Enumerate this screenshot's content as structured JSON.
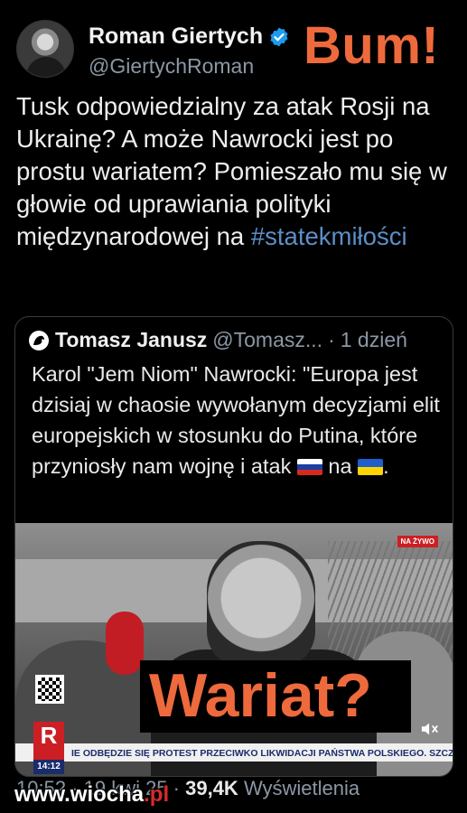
{
  "author": {
    "name": "Roman Giertych",
    "handle": "@GiertychRoman",
    "verified_color": "#1d9bf0"
  },
  "overlay_caption": "Bum!",
  "tweet": {
    "text": "Tusk odpowiedzialny za atak Rosji na Ukrainę? A może Nawrocki jest po prostu wariatem? Pomieszało mu się w głowie od uprawiania polityki międzynarodowej na ",
    "hashtag": "#statekmiłości"
  },
  "quote": {
    "name": "Tomasz Janusz",
    "handle": "@Tomasz...",
    "separator": "·",
    "time": "1 dzień",
    "text_before": "Karol \"Jem Niom\" Nawrocki: \"Europa jest dzisiaj w chaosie wywołanym decyzjami elit europejskich w stosunku do Putina, które przyniosły nam wojnę i atak ",
    "text_middle": " na ",
    "text_end": ".",
    "video": {
      "live_label": "NA ŻYWO",
      "overlay_caption": "Wariat?",
      "channel_logo": "R",
      "channel_time": "14:12",
      "ticker": "IE ODBĘDZIE SIĘ PROTEST PRZECIWKO LIKWIDACJI PAŃSTWA POLSKIEGO. SZCZEGÓŁY N"
    }
  },
  "footer": {
    "time": "10:52 · 19 kwi 25 ·",
    "views_count": "39,4K",
    "views_label": "Wyświetlenia"
  },
  "watermark": {
    "prefix": "www.",
    "brand": "wiocha",
    "suffix": ".pl"
  },
  "colors": {
    "accent_orange": "#ee6a3c",
    "hashtag": "#5b8fc7",
    "muted": "#8b98a5"
  },
  "icons": [
    "verified-badge-icon",
    "quoted-user-avatar-icon",
    "russia-flag-icon",
    "ukraine-flag-icon",
    "mute-icon",
    "qr-code-icon"
  ]
}
